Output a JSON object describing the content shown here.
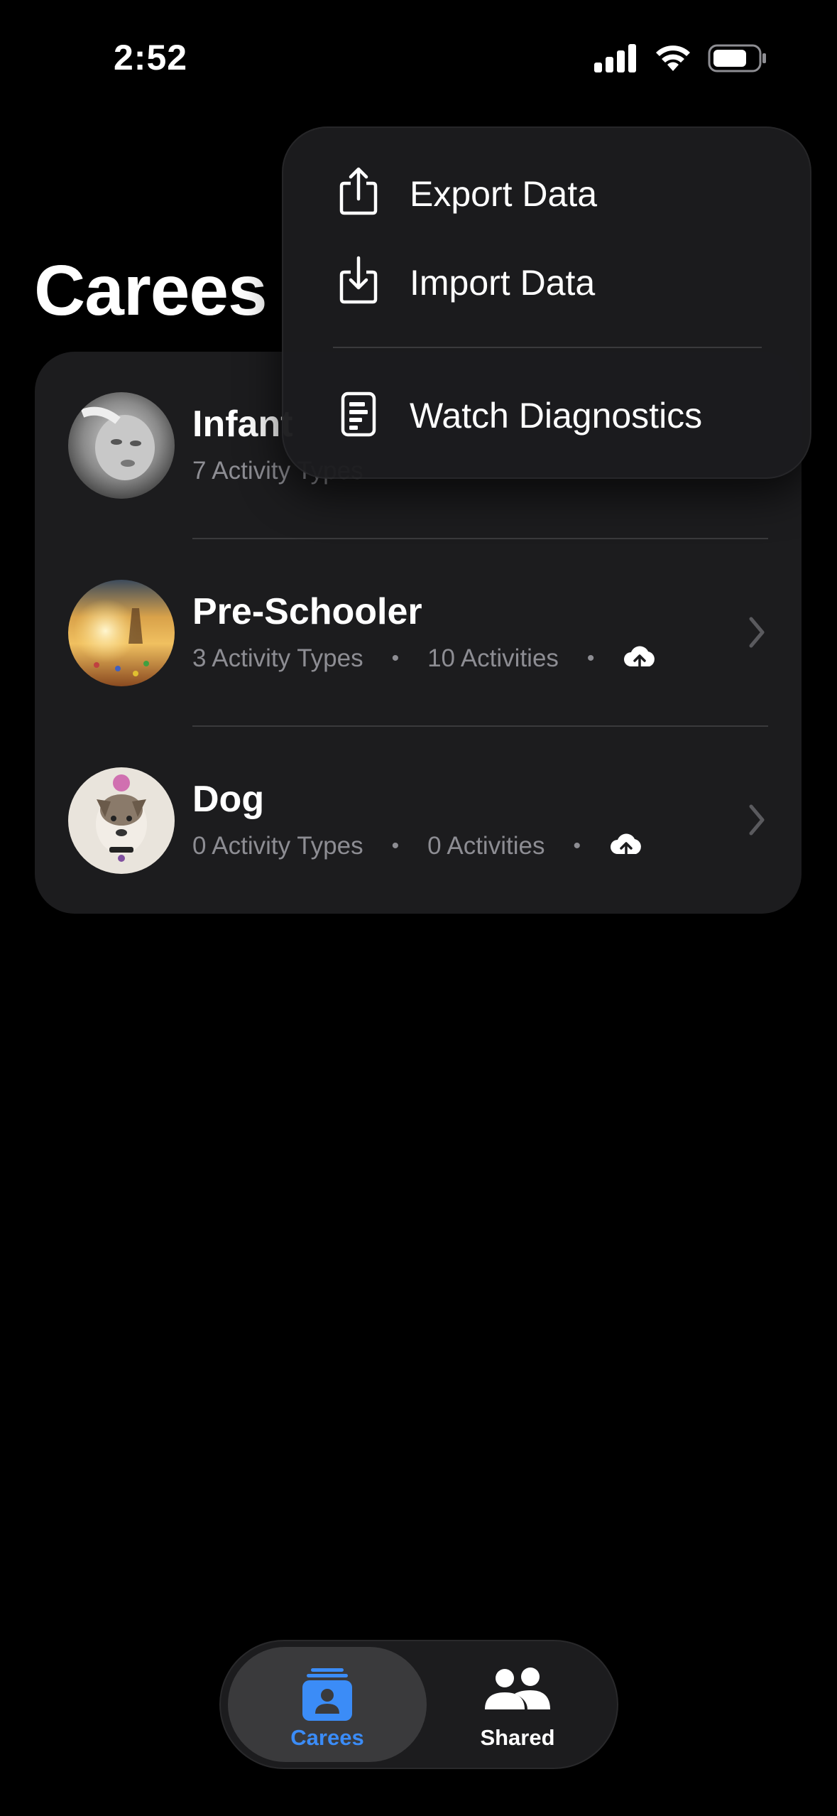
{
  "status_bar": {
    "time": "2:52"
  },
  "page": {
    "title": "Carees"
  },
  "carees": [
    {
      "name": "Infant",
      "activity_types": "7 Activity Types",
      "activities": "",
      "icon": "cloud-upload-icon"
    },
    {
      "name": "Pre-Schooler",
      "activity_types": "3 Activity Types",
      "activities": "10 Activities",
      "icon": "cloud-upload-icon"
    },
    {
      "name": "Dog",
      "activity_types": "0 Activity Types",
      "activities": "0 Activities",
      "icon": "cloud-upload-icon"
    }
  ],
  "menu": {
    "items": [
      {
        "label": "Export Data",
        "icon": "share-export-icon"
      },
      {
        "label": "Import Data",
        "icon": "import-icon"
      },
      {
        "label": "Watch Diagnostics",
        "icon": "document-icon"
      }
    ]
  },
  "tabbar": {
    "tabs": [
      {
        "label": "Carees",
        "icon": "person-stack-icon",
        "selected": true
      },
      {
        "label": "Shared",
        "icon": "people-icon",
        "selected": false
      }
    ]
  },
  "colors": {
    "accent": "#3b8cf7",
    "card": "#1c1c1e",
    "secondary_text": "#8d8d93"
  }
}
